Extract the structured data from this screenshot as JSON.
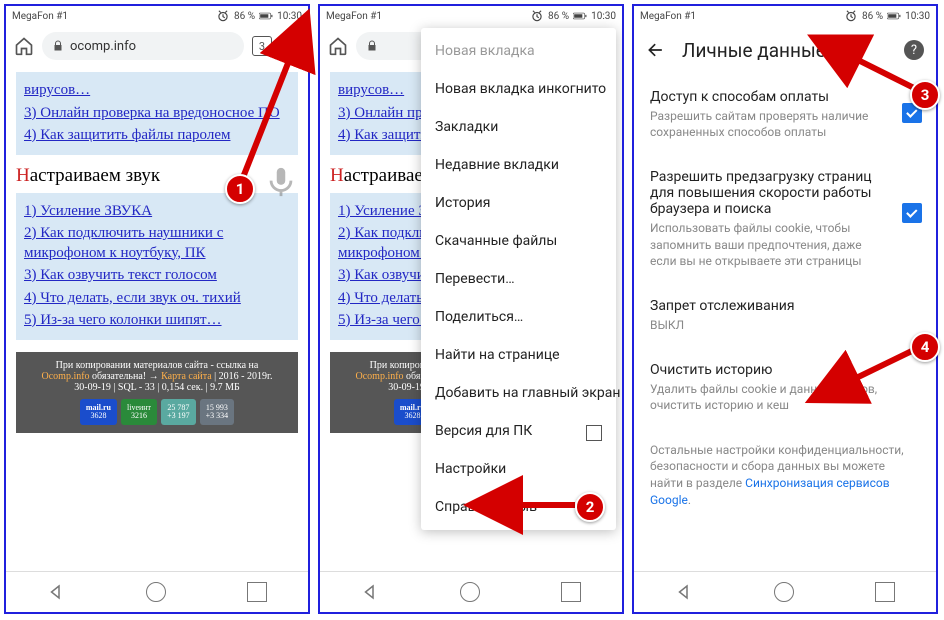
{
  "status": {
    "carrier": "MegaFon #1",
    "battery": "86 %",
    "time": "10:30"
  },
  "p1": {
    "url": "ocomp.info",
    "tabs": "3",
    "links_top": [
      "вирусов…",
      "3) Онлайн проверка на вредоносное ПО",
      "4) Как защитить файлы паролем"
    ],
    "sound_title_pre": "Н",
    "sound_title_rest": "астраиваем звук",
    "links_sound": [
      "1) Усиление ЗВУКА",
      "2) Как подключить наушники с микрофоном к ноутбуку, ПК",
      "3) Как озвучить текст голосом",
      "4) Что делать, если звук оч. тихий",
      "5) Из-за чего колонки шипят…"
    ],
    "footer": {
      "line1": "При копировании материалов сайта - ссылка на",
      "site": "Ocomp.info",
      "req": " обязательна!  →  ",
      "map": "Карта сайта",
      "years": " | 2016 - 2019г.",
      "stats": "30-09-19 | SQL - 33 | 0,154 сек. | 9.7 МБ",
      "b1": "mail.ru",
      "b1s": "3628",
      "b2": "3216",
      "b3": "25 787",
      "b3b": "+3 197",
      "b4": "15 993",
      "b4b": "+3 334"
    }
  },
  "menu": {
    "new_tab": "Новая вкладка",
    "items": [
      "Новая вкладка инкогнито",
      "Закладки",
      "Недавние вкладки",
      "История",
      "Скачанные файлы",
      "Перевести…",
      "Поделиться…",
      "Найти на странице",
      "Добавить на главный экран",
      "Версия для ПК",
      "Настройки",
      "Справка/отзыв"
    ]
  },
  "settings": {
    "title": "Личные данные",
    "rows": [
      {
        "t": "Доступ к способам оплаты",
        "d": "Разрешить сайтам проверять наличие сохраненных способов оплаты",
        "chk": true
      },
      {
        "t": "Разрешить предзагрузку страниц для повышения скорости работы браузера и поиска",
        "d": "Использовать файлы cookie, чтобы запомнить ваши предпочтения, даже если вы не открываете эти страницы",
        "chk": true
      },
      {
        "t": "Запрет отслеживания",
        "d": "ВЫКЛ",
        "chk": false
      },
      {
        "t": "Очистить историю",
        "d": "Удалить файлы cookie и данные сайтов, очистить историю и кеш",
        "chk": false
      }
    ],
    "note_pre": "Остальные настройки конфиденциальности, безопасности и сбора данных вы можете найти в разделе ",
    "note_link": "Синхронизация сервисов Google"
  }
}
